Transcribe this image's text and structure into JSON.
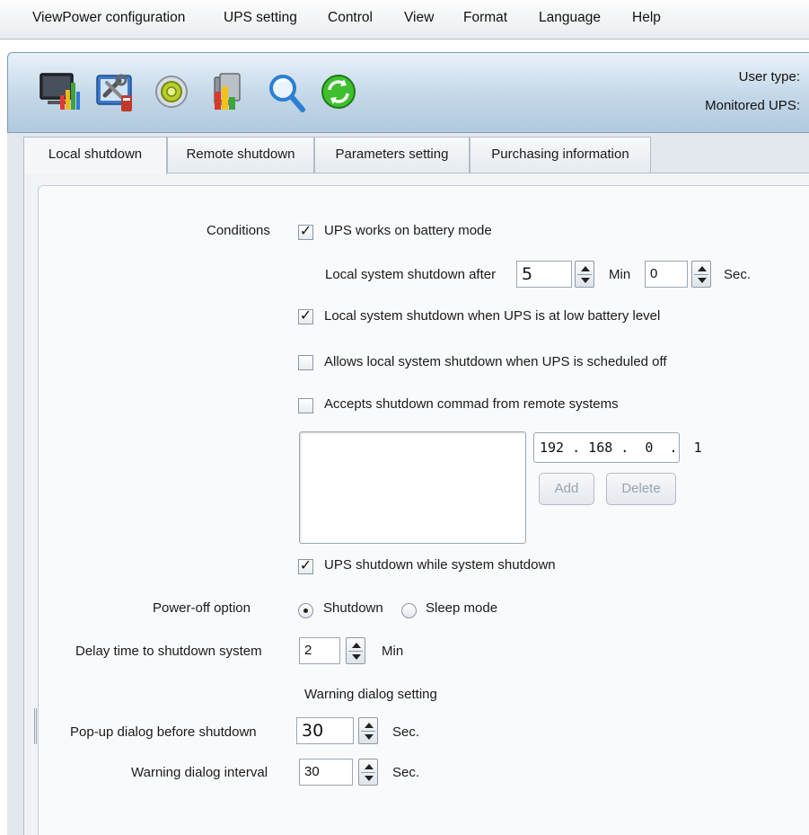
{
  "menu": [
    "ViewPower configuration",
    "UPS setting",
    "Control",
    "View",
    "Format",
    "Language",
    "Help"
  ],
  "toolbar": {
    "icons": [
      "monitor-chart-icon",
      "tools-icon",
      "settings-gear-icon",
      "documents-chart-icon",
      "magnifier-icon",
      "refresh-icon"
    ],
    "user_type_label": "User type:",
    "monitored_ups_label": "Monitored UPS:"
  },
  "tabs": [
    "Local shutdown",
    "Remote shutdown",
    "Parameters setting",
    "Purchasing information"
  ],
  "active_tab": "Local shutdown",
  "form": {
    "conditions_label": "Conditions",
    "battery_mode": {
      "label": "UPS works on battery mode",
      "checked": true
    },
    "shutdown_after": {
      "label": "Local system shutdown after",
      "min_value": "5",
      "min_unit": "Min",
      "sec_value": "0",
      "sec_unit": "Sec."
    },
    "low_battery": {
      "label": "Local system shutdown when UPS is at low battery level",
      "checked": true
    },
    "scheduled_off": {
      "label": "Allows local system shutdown when UPS is scheduled off",
      "checked": false
    },
    "remote_command": {
      "label": "Accepts shutdown commad from remote systems",
      "checked": false
    },
    "ip_address": "192 . 168 .  0  .  1",
    "add_button": "Add",
    "delete_button": "Delete",
    "ups_shutdown": {
      "label": "UPS shutdown while system shutdown",
      "checked": true
    },
    "power_off_label": "Power-off option",
    "power_off_options": [
      "Shutdown",
      "Sleep mode"
    ],
    "power_off_selected": "Shutdown",
    "delay_label": "Delay time to shutdown system",
    "delay_value": "2",
    "delay_unit": "Min",
    "warning_heading": "Warning dialog setting",
    "popup_label": "Pop-up dialog before shutdown",
    "popup_value": "30",
    "popup_unit": "Sec.",
    "interval_label": "Warning dialog interval",
    "interval_value": "30",
    "interval_unit": "Sec."
  }
}
